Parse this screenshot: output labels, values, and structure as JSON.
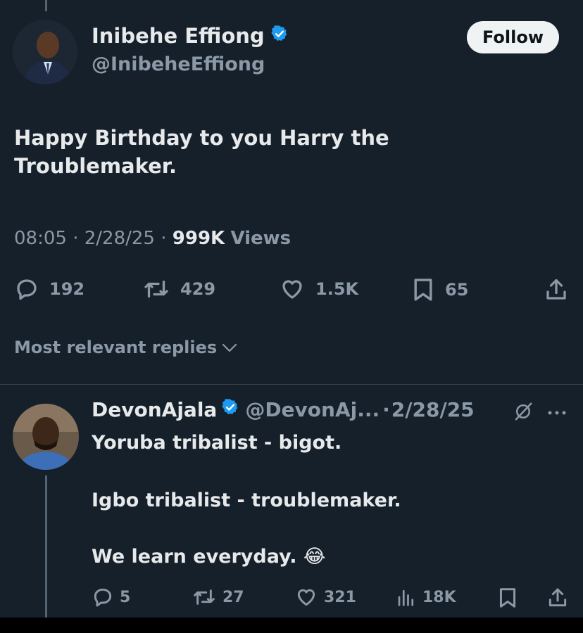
{
  "tweet": {
    "author_name": "Inibehe Effiong",
    "author_handle": "@InibeheEffiong",
    "follow_label": "Follow",
    "text_line1": "Happy Birthday to you Harry the",
    "text_line2": "Troublemaker.",
    "time": "08:05",
    "date": "2/28/25",
    "sep": "·",
    "views_count": "999K",
    "views_label": "Views",
    "replies": "192",
    "reposts": "429",
    "likes": "1.5K",
    "bookmarks": "65"
  },
  "sort_label": "Most relevant replies",
  "reply": {
    "author_name": "DevonAjala",
    "author_handle": "@DevonAj...",
    "date": "2/28/25",
    "sep": "·",
    "para1": "Yoruba tribalist - bigot.",
    "para2": "Igbo tribalist - troublemaker.",
    "para3": "We learn everyday.",
    "emoji": "😂",
    "replies": "5",
    "reposts": "27",
    "likes": "321",
    "views": "18K"
  },
  "colors": {
    "background": "#15202b",
    "text": "#e7e9ea",
    "muted": "#8b98a5",
    "verified": "#1d9bf0",
    "follow_bg": "#eff3f4"
  },
  "icons": [
    "verified-badge-icon",
    "reply-icon",
    "repost-icon",
    "like-icon",
    "bookmark-icon",
    "share-icon",
    "views-icon",
    "grok-icon",
    "more-icon",
    "chevron-down-icon"
  ]
}
